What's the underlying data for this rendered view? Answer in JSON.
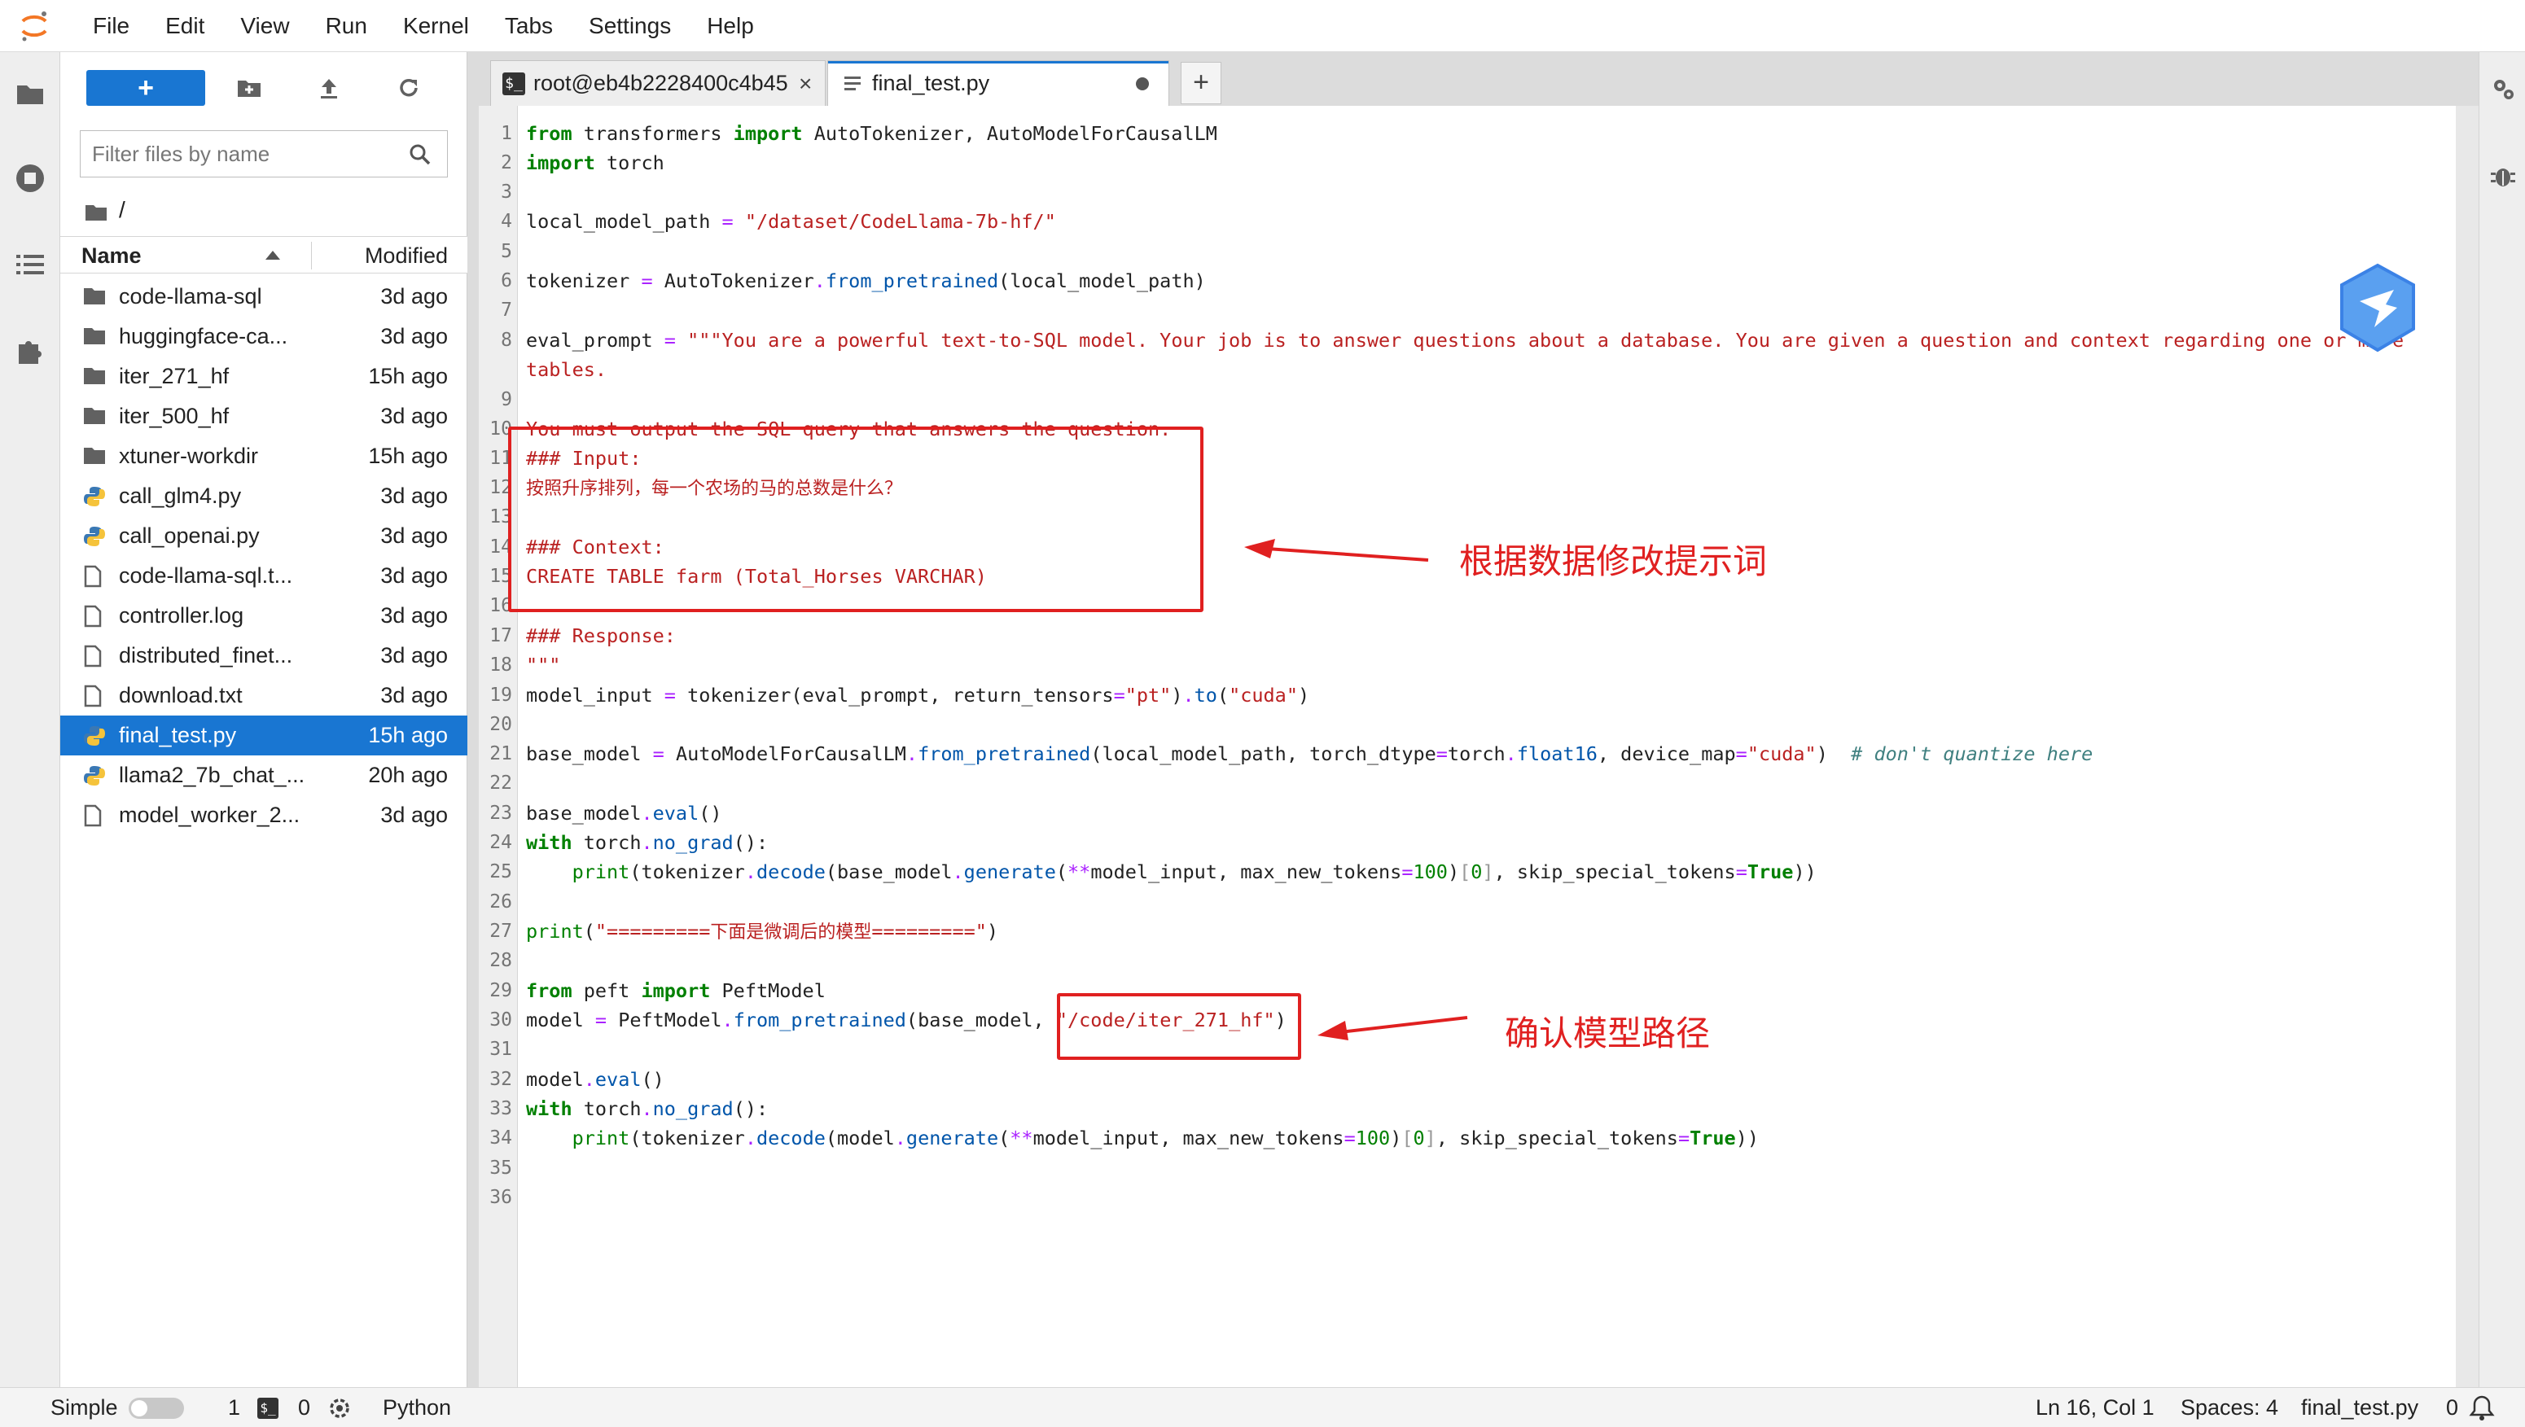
{
  "menu": [
    "File",
    "Edit",
    "View",
    "Run",
    "Kernel",
    "Tabs",
    "Settings",
    "Help"
  ],
  "filebrowser": {
    "new_label": "+",
    "search_placeholder": "Filter files by name",
    "breadcrumb": "/",
    "columns": {
      "name": "Name",
      "modified": "Modified"
    },
    "files": [
      {
        "name": "code-llama-sql",
        "modified": "3d ago",
        "type": "folder"
      },
      {
        "name": "huggingface-ca...",
        "modified": "3d ago",
        "type": "folder"
      },
      {
        "name": "iter_271_hf",
        "modified": "15h ago",
        "type": "folder"
      },
      {
        "name": "iter_500_hf",
        "modified": "3d ago",
        "type": "folder"
      },
      {
        "name": "xtuner-workdir",
        "modified": "15h ago",
        "type": "folder"
      },
      {
        "name": "call_glm4.py",
        "modified": "3d ago",
        "type": "python"
      },
      {
        "name": "call_openai.py",
        "modified": "3d ago",
        "type": "python"
      },
      {
        "name": "code-llama-sql.t...",
        "modified": "3d ago",
        "type": "file"
      },
      {
        "name": "controller.log",
        "modified": "3d ago",
        "type": "file"
      },
      {
        "name": "distributed_finet...",
        "modified": "3d ago",
        "type": "file"
      },
      {
        "name": "download.txt",
        "modified": "3d ago",
        "type": "file"
      },
      {
        "name": "final_test.py",
        "modified": "15h ago",
        "type": "python",
        "selected": true
      },
      {
        "name": "llama2_7b_chat_...",
        "modified": "20h ago",
        "type": "python"
      },
      {
        "name": "model_worker_2...",
        "modified": "3d ago",
        "type": "file"
      }
    ]
  },
  "tabs": [
    {
      "label": "root@eb4b2228400c4b45",
      "icon": "terminal-icon",
      "active": false
    },
    {
      "label": "final_test.py",
      "icon": "file-icon",
      "active": true
    }
  ],
  "tab_add": "+",
  "tab_close": "×",
  "term_glyph": "$_",
  "editor": {
    "lines": [
      "1",
      "2",
      "3",
      "4",
      "5",
      "6",
      "7",
      "8",
      "",
      "9",
      "10",
      "11",
      "12",
      "13",
      "14",
      "15",
      "16",
      "17",
      "18",
      "19",
      "20",
      "21",
      "22",
      "23",
      "24",
      "25",
      "26",
      "27",
      "28",
      "29",
      "30",
      "31",
      "32",
      "33",
      "34",
      "35",
      "36"
    ]
  },
  "annotations": [
    {
      "text": "根据数据修改提示词",
      "color": "#e02020"
    },
    {
      "text": "确认模型路径",
      "color": "#e02020"
    }
  ],
  "statusbar": {
    "mode": "Simple",
    "terminals": "1",
    "kernels": "0",
    "kernel_name": "Python",
    "cursor": "Ln 16, Col 1",
    "spaces": "Spaces: 4",
    "filename": "final_test.py",
    "notifications": "0"
  }
}
